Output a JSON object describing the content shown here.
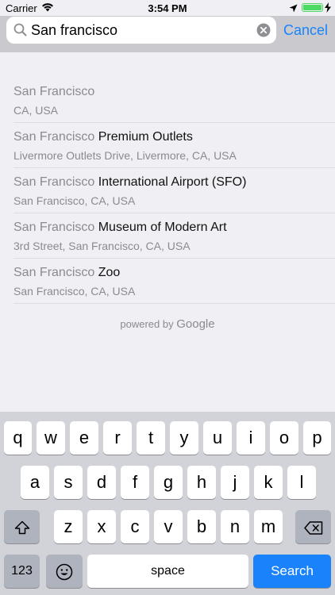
{
  "status_bar": {
    "carrier": "Carrier",
    "time": "3:54 PM",
    "battery_color": "#4cd964",
    "icons": [
      "wifi-icon",
      "location-arrow-icon",
      "battery-icon",
      "charging-bolt-icon"
    ]
  },
  "search": {
    "value": "San francisco",
    "cancel_label": "Cancel",
    "accent_color": "#1a82fb"
  },
  "results": [
    {
      "match": "San Francisco",
      "rest": "",
      "secondary": "CA, USA"
    },
    {
      "match": "San Francisco",
      "rest": " Premium Outlets",
      "secondary": "Livermore Outlets Drive, Livermore, CA, USA"
    },
    {
      "match": "San Francisco",
      "rest": " International Airport (SFO)",
      "secondary": "San Francisco, CA, USA"
    },
    {
      "match": "San Francisco",
      "rest": " Museum of Modern Art",
      "secondary": "3rd Street, San Francisco, CA, USA"
    },
    {
      "match": "San Francisco",
      "rest": " Zoo",
      "secondary": "San Francisco, CA, USA"
    }
  ],
  "attribution": {
    "prefix": "powered by",
    "brand": "Google"
  },
  "keyboard": {
    "row1": [
      "q",
      "w",
      "e",
      "r",
      "t",
      "y",
      "u",
      "i",
      "o",
      "p"
    ],
    "row2": [
      "a",
      "s",
      "d",
      "f",
      "g",
      "h",
      "j",
      "k",
      "l"
    ],
    "row3": [
      "z",
      "x",
      "c",
      "v",
      "b",
      "n",
      "m"
    ],
    "numbers_label": "123",
    "space_label": "space",
    "search_label": "Search"
  }
}
